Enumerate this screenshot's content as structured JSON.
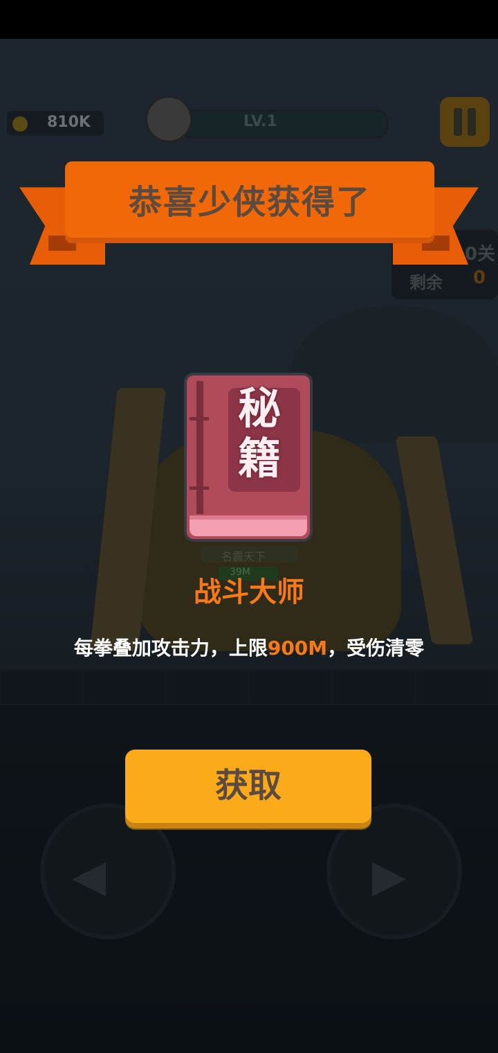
{
  "status_bar": {},
  "hud": {
    "coins": "810K",
    "level": "LV.1",
    "stage_fragment": "0关",
    "remaining_label": "剩余",
    "remaining_count": "0"
  },
  "background_scene": {
    "banner_fragment": "名震天下",
    "hp_fragment": "39M"
  },
  "reward_popup": {
    "title": "恭喜少侠获得了",
    "book_text": "秘籍",
    "item_name": "战斗大师",
    "description_prefix": "每拳叠加攻击力，上限",
    "description_highlight": "900M",
    "description_suffix": "，受伤清零",
    "claim_label": "获取"
  },
  "colors": {
    "ribbon": "#f06808",
    "accent_orange": "#f7791a",
    "button_yellow": "#fbab1a",
    "book_red": "#b04b5c"
  },
  "icons": [
    "coin-icon",
    "avatar-icon",
    "pause-icon",
    "skull-icon",
    "left-arrow-icon",
    "right-arrow-icon",
    "book-icon"
  ]
}
